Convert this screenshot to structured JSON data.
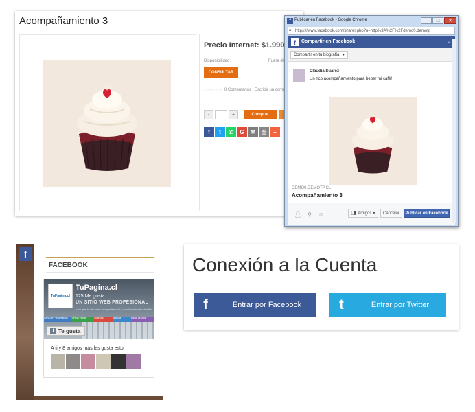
{
  "product": {
    "title": "Acompañamiento 3",
    "price_label": "Precio Internet: $1.990",
    "availability_label": "Disponibilidad:",
    "availability_value": "Fuera de",
    "consult_button": "CONSULTAR",
    "reviews": "0 Comentarios | Escribir un comen",
    "qty_minus": "-",
    "qty_value": "1",
    "qty_plus": "+",
    "buy_button": "Comprar",
    "share_icons": [
      "facebook-icon",
      "twitter-icon",
      "whatsapp-icon",
      "google-plus-icon",
      "email-icon",
      "print-icon",
      "more-icon"
    ]
  },
  "fb_window": {
    "title": "Publicar en Facebook - Google Chrome",
    "url": "https://www.facebook.com/sharer.php?u=http%3A%2F%2Fdemo0.demotp",
    "header": "Compartir en Facebook",
    "destination": "Compartir en tu biografía",
    "user_name": "Claudia Suarez",
    "message": "Un rico acompañamiento para beber mi café!",
    "link_domain": "DEMO0.DEMOTP.CL",
    "link_title": "Acompañamiento 3",
    "audience_button": "Amigos",
    "cancel_button": "Cancelar",
    "publish_button": "Publicar en Facebook"
  },
  "fb_widget": {
    "section_title": "FACEBOOK",
    "page_name": "TuPagina.cl",
    "page_likes": "125 Me gusta",
    "slogan": "UN SITIO WEB PROFESIONAL",
    "slogan_sub": "para que tu sitio web sea profesional y con los mejores diseños",
    "logo_text": "TuPagina.cl",
    "cover_tabs": [
      "Carta de Presentación",
      "Tienda Virtual",
      "Galerías",
      "Noticias",
      "Editor de Dise"
    ],
    "like_button": "Te gusta",
    "friends_text": "A ti y 8 amigos más les gusta esto"
  },
  "login": {
    "title": "Conexión a la Cuenta",
    "facebook_button": "Entrar por Facebook",
    "twitter_button": "Entrar por Twitter"
  },
  "colors": {
    "facebook": "#3b5998",
    "twitter": "#28aae1",
    "orange": "#e46c12"
  }
}
